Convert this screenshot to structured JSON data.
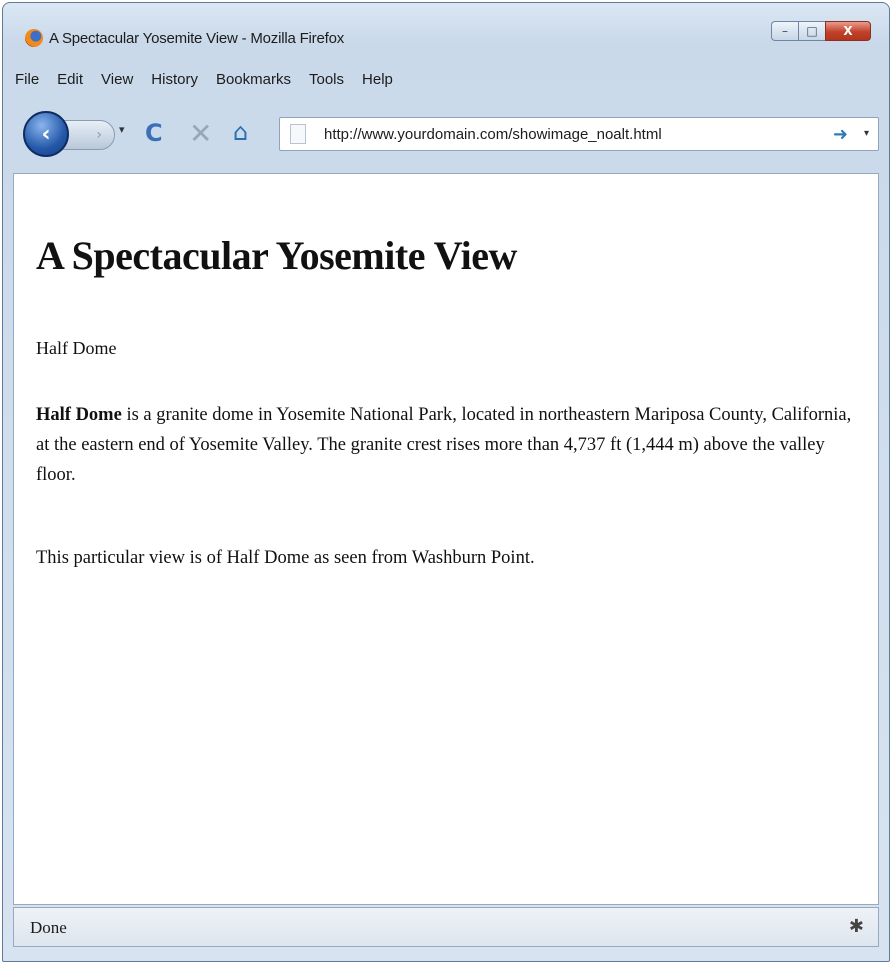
{
  "window": {
    "title": "A Spectacular Yosemite View - Mozilla Firefox",
    "buttons": {
      "minimize": "–",
      "maximize": "□",
      "close": "X"
    }
  },
  "menu": {
    "items": [
      "File",
      "Edit",
      "View",
      "History",
      "Bookmarks",
      "Tools",
      "Help"
    ]
  },
  "navbar": {
    "back": "‹",
    "forward": "›",
    "reload": "C",
    "stop": "✕",
    "home": "⌂",
    "url": "http://www.yourdomain.com/showimage_noalt.html",
    "go": "➜",
    "dropdown": "▾"
  },
  "page": {
    "heading": "A Spectacular Yosemite View",
    "image_alt_placeholder": "Half Dome",
    "paragraph1_bold": "Half Dome",
    "paragraph1_rest": " is a granite dome in Yosemite National Park, located in northeastern Mariposa County, California, at the eastern end of Yosemite Valley. The granite crest rises more than 4,737 ft (1,444 m) above the valley floor.",
    "paragraph2": "This particular view is of Half Dome as seen from Washburn Point."
  },
  "status": {
    "text": "Done"
  }
}
